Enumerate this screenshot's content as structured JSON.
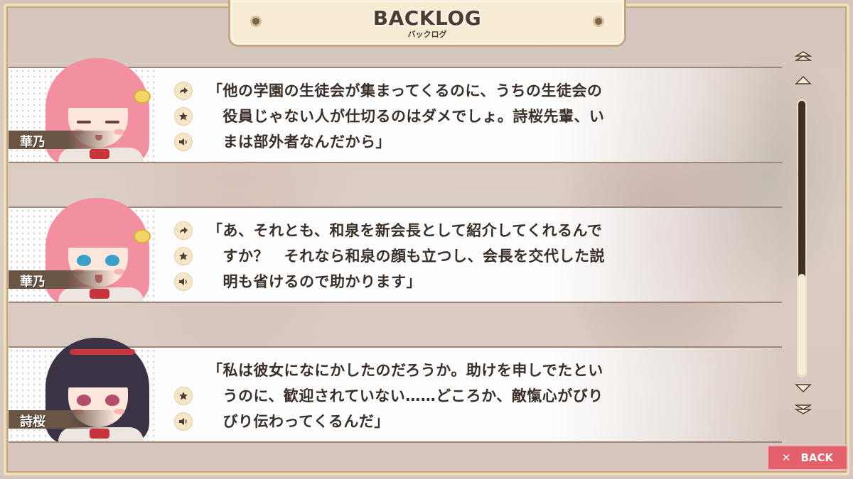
{
  "title": {
    "main": "BACKLOG",
    "sub": "バックログ"
  },
  "entries": [
    {
      "speaker": "華乃",
      "portrait_icon": "pink-haired-girl-eyes-closed-portrait",
      "actions": [
        "jump-icon",
        "favorite-star-icon",
        "replay-voice-icon"
      ],
      "lines": [
        "「他の学園の生徒会が集まってくるのに、うちの生徒会の",
        "　役員じゃない人が仕切るのはダメでしょ。詩桜先輩、い",
        "　まは部外者なんだから」"
      ]
    },
    {
      "speaker": "華乃",
      "portrait_icon": "pink-haired-girl-smiling-portrait",
      "actions": [
        "jump-icon",
        "favorite-star-icon",
        "replay-voice-icon"
      ],
      "lines": [
        "「あ、それとも、和泉を新会長として紹介してくれるんで",
        "　すか？　それなら和泉の顔も立つし、会長を交代した説",
        "　明も省けるので助かります」"
      ]
    },
    {
      "speaker": "詩桜",
      "portrait_icon": "dark-haired-girl-portrait",
      "actions": [
        "favorite-star-icon",
        "replay-voice-icon"
      ],
      "lines": [
        "「私は彼女になにかしたのだろうか。助けを申しでたとい",
        "　うのに、歓迎されていない……どころか、敵愾心がびり",
        "　びり伝わってくるんだ」"
      ]
    }
  ],
  "scrollbar": {
    "thumb_fraction": 0.37,
    "buttons": [
      "page-up-icon",
      "line-up-icon",
      "line-down-icon",
      "page-down-icon"
    ]
  },
  "back_button": {
    "icon": "close-x-icon",
    "label": "BACK"
  },
  "colors": {
    "frame": "#ede0b8",
    "text": "#3a2f29",
    "accent_back": "#e2616b",
    "name_plate": "#6b5545"
  }
}
